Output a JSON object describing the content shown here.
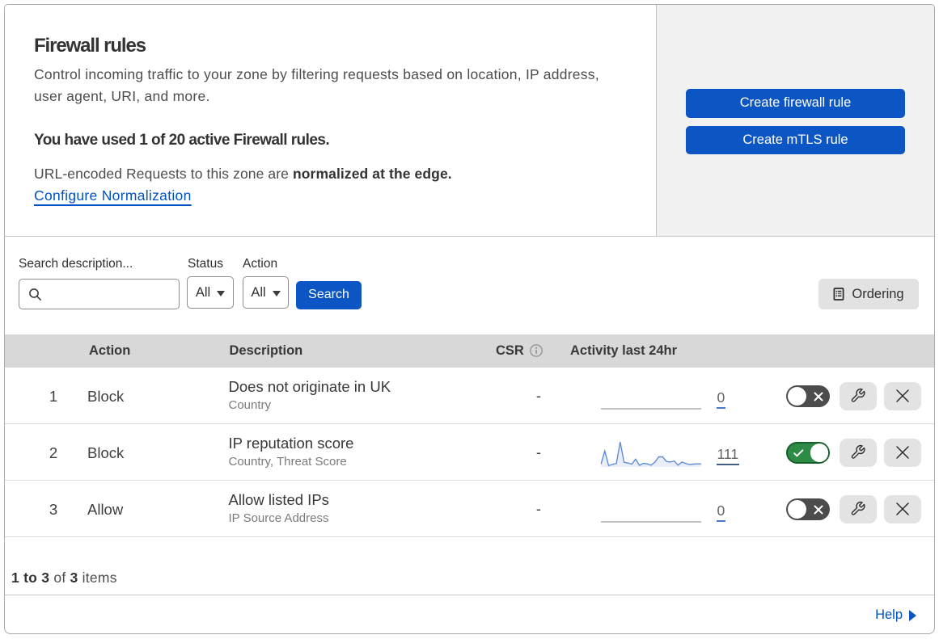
{
  "hero": {
    "title": "Firewall rules",
    "description": "Control incoming traffic to your zone by filtering requests based on location, IP address, user agent, URI, and more.",
    "usage_note": "You have used 1 of 20 active Firewall rules.",
    "normalization_prefix": "URL-encoded Requests to this zone are ",
    "normalization_bold": "normalized at the edge.",
    "normalization_link": "Configure Normalization",
    "create_firewall_button": "Create firewall rule",
    "create_mtls_button": "Create mTLS rule"
  },
  "filters": {
    "search_label": "Search description...",
    "status_label": "Status",
    "status_value": "All",
    "action_label": "Action",
    "action_value": "All",
    "search_button": "Search",
    "ordering_button": "Ordering"
  },
  "table": {
    "headers": {
      "action": "Action",
      "description": "Description",
      "csr": "CSR",
      "activity": "Activity last 24hr"
    },
    "rows": [
      {
        "index": "1",
        "action": "Block",
        "description": "Does not originate in UK",
        "sub": "Country",
        "csr": "-",
        "count": "0",
        "enabled": false,
        "underline_color": "#4c78cc"
      },
      {
        "index": "2",
        "action": "Block",
        "description": "IP reputation score",
        "sub": "Country, Threat Score",
        "csr": "-",
        "count": "111",
        "enabled": true,
        "underline_color": "#3f5f84"
      },
      {
        "index": "3",
        "action": "Allow",
        "description": "Allow listed IPs",
        "sub": "IP Source Address",
        "csr": "-",
        "count": "0",
        "enabled": false,
        "underline_color": "#4c78cc"
      }
    ]
  },
  "footer": {
    "range": "1 to 3",
    "of": " of ",
    "total": "3",
    "items": " items"
  },
  "help": {
    "label": "Help"
  },
  "chart_data": {
    "type": "area",
    "title": "Activity last 24hr sparklines",
    "series": [
      {
        "name": "rule-1-activity",
        "values": [
          0,
          0,
          0,
          0,
          0,
          0,
          0,
          0,
          0,
          0,
          0,
          0,
          0,
          0,
          0,
          0,
          0,
          0,
          0,
          0,
          0,
          0,
          0,
          0,
          0,
          0
        ],
        "total": 0
      },
      {
        "name": "rule-2-activity",
        "values": [
          10,
          62,
          5,
          10,
          13,
          97,
          18,
          15,
          11,
          30,
          6,
          14,
          12,
          7,
          19,
          39,
          39,
          21,
          19,
          23,
          7,
          19,
          13,
          9,
          11,
          12,
          12
        ],
        "total": 111
      },
      {
        "name": "rule-3-activity",
        "values": [
          0,
          0,
          0,
          0,
          0,
          0,
          0,
          0,
          0,
          0,
          0,
          0,
          0,
          0,
          0,
          0,
          0,
          0,
          0,
          0,
          0,
          0,
          0,
          0,
          0,
          0
        ],
        "total": 0
      }
    ],
    "ylim": [
      0,
      100
    ],
    "line_color": "#5f8dd9",
    "fill_color": "#e9eef9",
    "empty_line_color": "#9b9b9b"
  },
  "colors": {
    "primary_blue": "#0b55c4",
    "link_blue": "#0051c3",
    "toggle_on_green": "#2e8c46",
    "toggle_off_gray": "#4c4c4c",
    "header_gray": "#d8d8d8",
    "panel_gray": "#f1f1f1"
  }
}
